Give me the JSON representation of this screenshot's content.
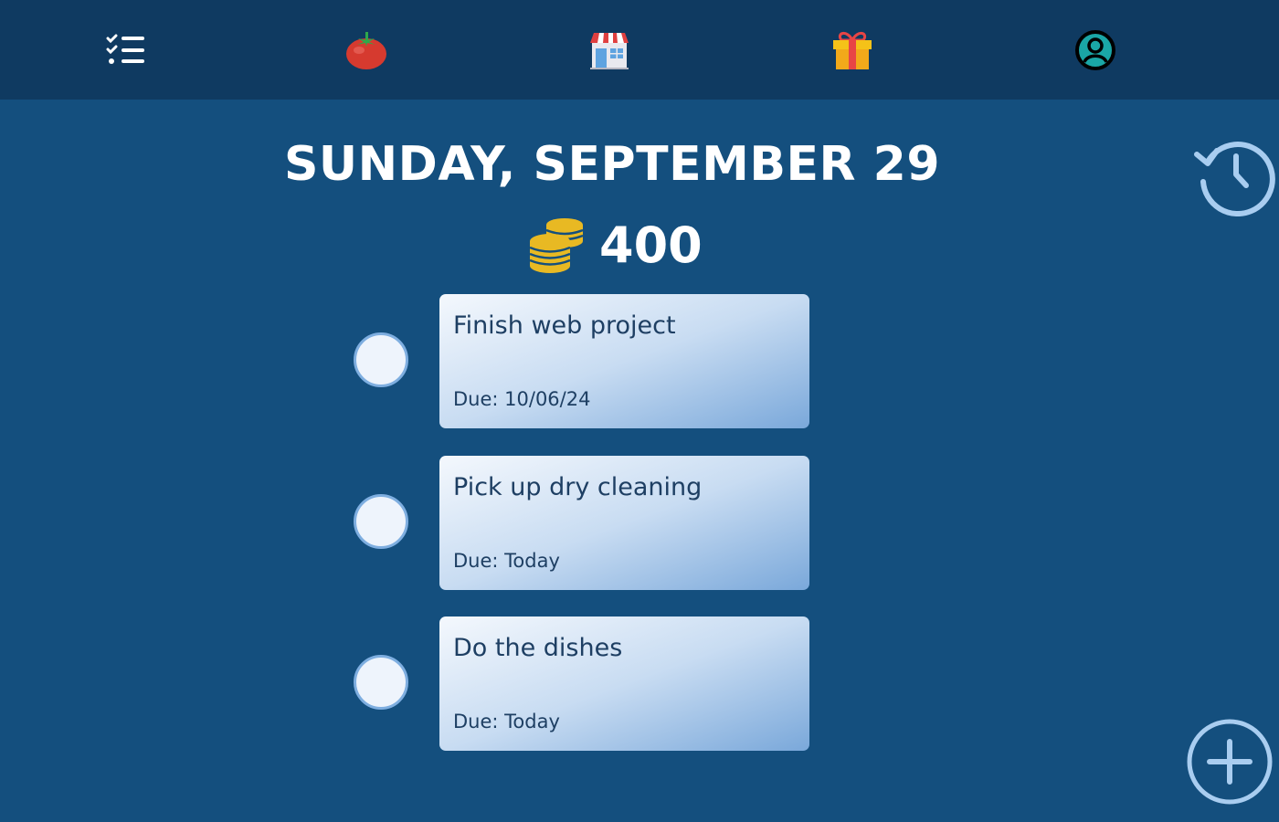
{
  "nav": {
    "items": [
      {
        "icon": "checklist-icon"
      },
      {
        "icon": "tomato-icon"
      },
      {
        "icon": "store-icon"
      },
      {
        "icon": "gift-icon"
      },
      {
        "icon": "profile-icon"
      }
    ]
  },
  "header": {
    "date": "SUNDAY, SEPTEMBER 29",
    "coins": "400"
  },
  "tasks": [
    {
      "title": "Finish web project",
      "due": "Due: 10/06/24"
    },
    {
      "title": "Pick up dry cleaning",
      "due": "Due: Today"
    },
    {
      "title": "Do the dishes",
      "due": "Due: Today"
    }
  ],
  "colors": {
    "background": "#144f7e",
    "navbar": "#0f3a61",
    "coin": "#e8b923",
    "accent_outline": "#a9cdf0"
  }
}
